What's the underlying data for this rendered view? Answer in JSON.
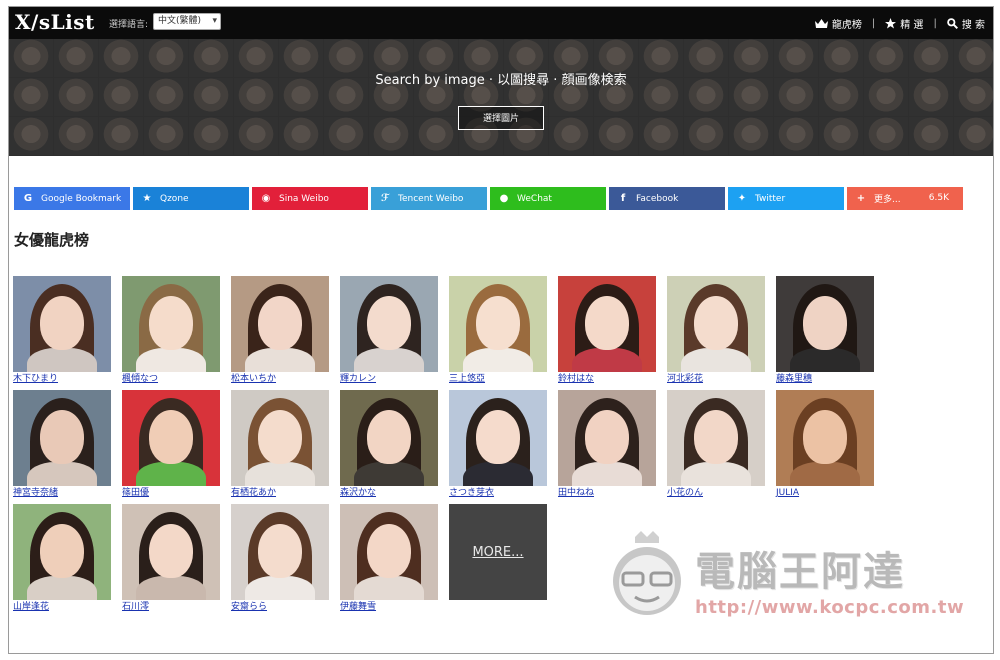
{
  "header": {
    "logo": "X/sList",
    "lang_label": "選擇語言:",
    "lang_selected": "中文(繁體)",
    "nav": [
      {
        "icon": "crown-icon",
        "label": "龍虎榜"
      },
      {
        "icon": "star-icon",
        "label": "精 選"
      },
      {
        "icon": "search-icon",
        "label": "搜 索"
      }
    ]
  },
  "hero": {
    "title": "Search by image · 以圖搜尋 · 顔画像検索",
    "button_label": "選擇圖片"
  },
  "share": [
    {
      "label": "Google Bookmark",
      "color": "#3b78e7",
      "icon": "google-icon"
    },
    {
      "label": "Qzone",
      "color": "#1a82d8",
      "icon": "qzone-star-icon"
    },
    {
      "label": "Sina Weibo",
      "color": "#e2203a",
      "icon": "weibo-icon"
    },
    {
      "label": "Tencent Weibo",
      "color": "#39a0d8",
      "icon": "tencent-weibo-icon"
    },
    {
      "label": "WeChat",
      "color": "#2ebd1d",
      "icon": "wechat-icon"
    },
    {
      "label": "Facebook",
      "color": "#3b5998",
      "icon": "facebook-icon"
    },
    {
      "label": "Twitter",
      "color": "#1da1f2",
      "icon": "twitter-icon"
    },
    {
      "label": "更多...",
      "color": "#f0624d",
      "icon": "plus-icon",
      "count": "6.5K"
    }
  ],
  "section_title": "女優龍虎榜",
  "actresses": [
    {
      "name": "木下ひまり",
      "bg": "#7d8ea8",
      "hair": "#4a2e22",
      "skin": "#f1d3c2",
      "body": "#cfc6c1"
    },
    {
      "name": "楓傾なつ",
      "bg": "#7f9a70",
      "hair": "#8a6a45",
      "skin": "#f5dccb",
      "body": "#efe8e2"
    },
    {
      "name": "松本いちか",
      "bg": "#b59a84",
      "hair": "#3a241a",
      "skin": "#f2d6c8",
      "body": "#e8dfd8"
    },
    {
      "name": "輝カレン",
      "bg": "#9aa7b2",
      "hair": "#2e2420",
      "skin": "#f3dbcd",
      "body": "#d8d2cf"
    },
    {
      "name": "三上悠亞",
      "bg": "#c9d2a9",
      "hair": "#9a6b3e",
      "skin": "#f6dfcf",
      "body": "#f1ece6"
    },
    {
      "name": "鈴村はな",
      "bg": "#c7413c",
      "hair": "#2c1c16",
      "skin": "#f4d9c9",
      "body": "#c03a46"
    },
    {
      "name": "河北彩花",
      "bg": "#cdd0b6",
      "hair": "#5a3a2a",
      "skin": "#f4dccd",
      "body": "#e9e4df"
    },
    {
      "name": "藤森里穗",
      "bg": "#3f3b3a",
      "hair": "#201814",
      "skin": "#efd3c4",
      "body": "#2b2a2a"
    },
    {
      "name": "神宮寺奈緒",
      "bg": "#6d7f8f",
      "hair": "#2a201c",
      "skin": "#e9c9b7",
      "body": "#d6c7bd"
    },
    {
      "name": "篠田優",
      "bg": "#d8333a",
      "hair": "#3a2a22",
      "skin": "#f0cdb6",
      "body": "#5fb34a"
    },
    {
      "name": "有栖花あか",
      "bg": "#cfcac4",
      "hair": "#7a5234",
      "skin": "#f4dccc",
      "body": "#e7e1db"
    },
    {
      "name": "森沢かな",
      "bg": "#6f6a4e",
      "hair": "#2a1e18",
      "skin": "#f2d5c4",
      "body": "#3e3a35"
    },
    {
      "name": "さつき芽衣",
      "bg": "#b9c7da",
      "hair": "#2b211c",
      "skin": "#f5dbcc",
      "body": "#2b2b33"
    },
    {
      "name": "田中ねね",
      "bg": "#b7a49a",
      "hair": "#2d211c",
      "skin": "#f1d2c2",
      "body": "#e8dcd6"
    },
    {
      "name": "小花のん",
      "bg": "#d6cfc8",
      "hair": "#3a2a22",
      "skin": "#f2d7c8",
      "body": "#e9e2dc"
    },
    {
      "name": "JULIA",
      "bg": "#b07d55",
      "hair": "#6b3f22",
      "skin": "#ecc2a4",
      "body": "#a06a45"
    },
    {
      "name": "山岸逢花",
      "bg": "#8fb37c",
      "hair": "#2c1e18",
      "skin": "#efcfba",
      "body": "#d9cfc6"
    },
    {
      "name": "石川澪",
      "bg": "#cfc1b6",
      "hair": "#2a1f1a",
      "skin": "#f3d8c8",
      "body": "#c9b8ad"
    },
    {
      "name": "安齋らら",
      "bg": "#d6d0cc",
      "hair": "#5a3a28",
      "skin": "#f4dccd",
      "body": "#eee9e5"
    },
    {
      "name": "伊藤舞雪",
      "bg": "#cdbfb6",
      "hair": "#4e2e20",
      "skin": "#f3d7c7",
      "body": "#e4dad3"
    }
  ],
  "more_label": "MORE...",
  "watermark": {
    "title": "電腦王阿達",
    "url": "http://www.kocpc.com.tw"
  }
}
